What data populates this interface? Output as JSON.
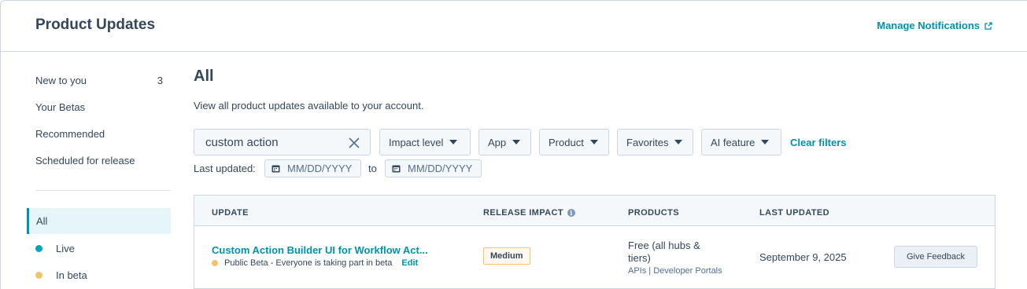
{
  "header": {
    "title": "Product Updates",
    "manage_notifications": "Manage Notifications"
  },
  "sidebar": {
    "items": [
      {
        "label": "New to you",
        "count": "3"
      },
      {
        "label": "Your Betas"
      },
      {
        "label": "Recommended"
      },
      {
        "label": "Scheduled for release"
      }
    ],
    "all_label": "All",
    "statuses": [
      {
        "label": "Live",
        "color": "#00a4bd"
      },
      {
        "label": "In beta",
        "color": "#f5c26b"
      }
    ]
  },
  "main": {
    "title": "All",
    "description": "View all product updates available to your account.",
    "search": {
      "value": "custom action"
    },
    "filters": [
      "Impact level",
      "App",
      "Product",
      "Favorites",
      "AI feature"
    ],
    "clear_filters": "Clear filters",
    "last_updated_label": "Last updated:",
    "date_from_placeholder": "MM/DD/YYYY",
    "to_label": "to",
    "date_to_placeholder": "MM/DD/YYYY"
  },
  "table": {
    "headers": {
      "update": "UPDATE",
      "release_impact": "RELEASE IMPACT",
      "products": "PRODUCTS",
      "last_updated": "LAST UPDATED"
    },
    "rows": [
      {
        "title": "Custom Action Builder UI for Workflow Act...",
        "status": "Public Beta - Everyone is taking part in beta",
        "status_color": "#f5c26b",
        "edit": "Edit",
        "impact": "Medium",
        "products_main": "Free (all hubs & tiers)",
        "products_sub": "APIs | Developer Portals",
        "last_updated": "September 9, 2025",
        "action": "Give Feedback"
      }
    ]
  },
  "colors": {
    "accent": "#0091ae",
    "text": "#33475b",
    "border": "#cbd6e2"
  }
}
